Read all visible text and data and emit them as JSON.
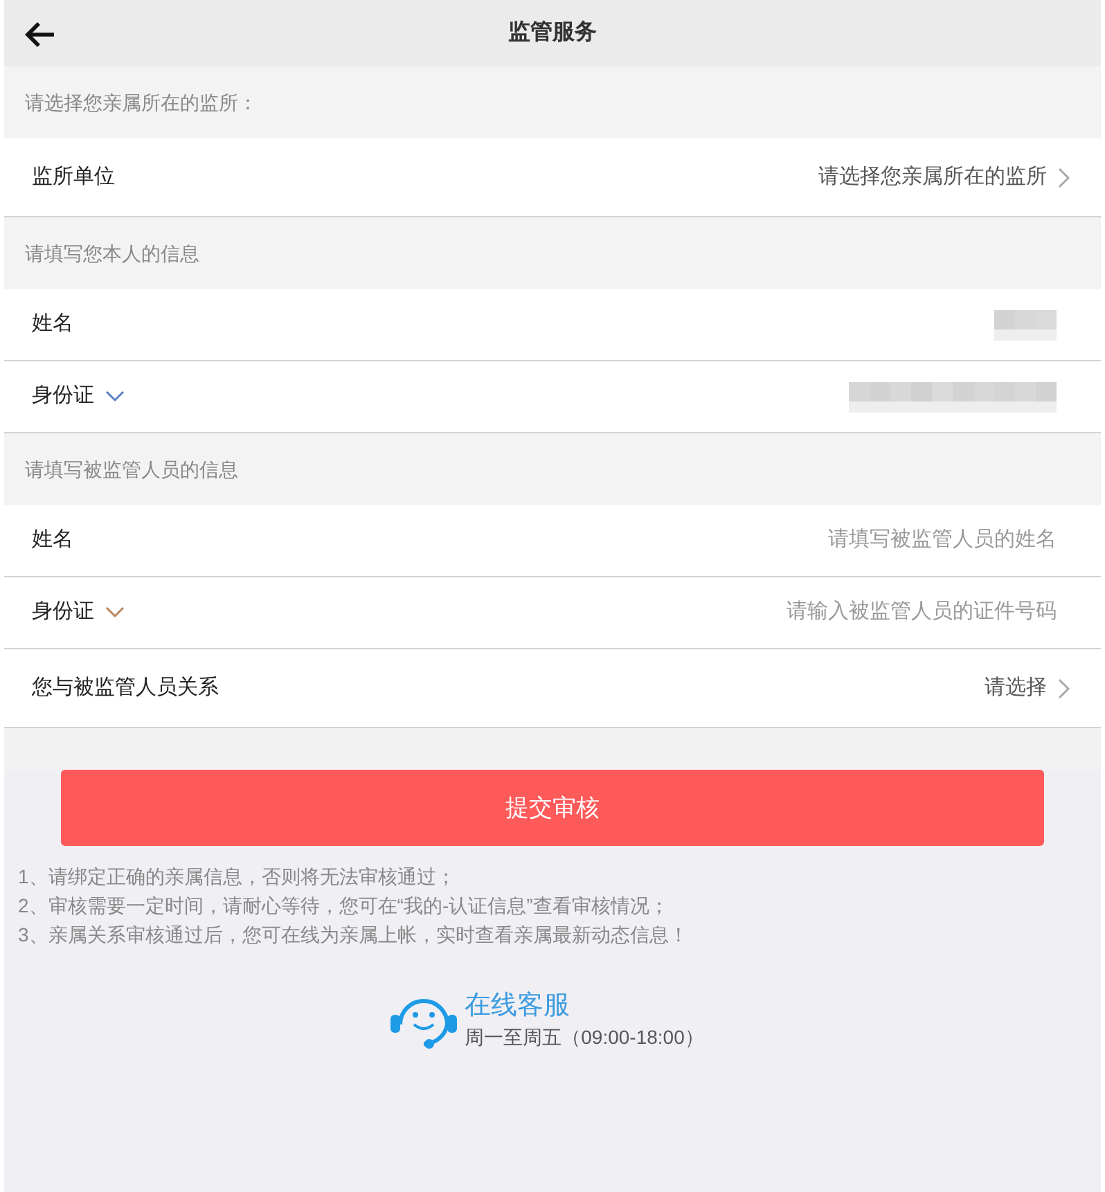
{
  "header": {
    "title": "监管服务"
  },
  "sections": [
    {
      "heading": "请选择您亲属所在的监所：",
      "rows": [
        {
          "kind": "select",
          "label": "监所单位",
          "value": "请选择您亲属所在的监所"
        }
      ]
    },
    {
      "heading": "请填写您本人的信息",
      "rows": [
        {
          "kind": "shortredacted",
          "label": "姓名"
        },
        {
          "kind": "longredacted",
          "label": "身份证",
          "caret": true,
          "color": "#5b7fc7"
        }
      ]
    },
    {
      "heading": "请填写被监管人员的信息",
      "rows": [
        {
          "kind": "input",
          "label": "姓名",
          "placeholder": "请填写被监管人员的姓名"
        },
        {
          "kind": "input",
          "label": "身份证",
          "placeholder": "请输入被监管人员的证件号码",
          "caret": true,
          "color": "#b8865a"
        },
        {
          "kind": "select",
          "label": "您与被监管人员关系",
          "value": "请选择"
        }
      ]
    }
  ],
  "submit": "提交审核",
  "notes": [
    "1、请绑定正确的亲属信息，否则将无法审核通过；",
    "2、审核需要一定时间，请耐心等待，您可在“我的-认证信息”查看审核情况；",
    "3、亲属关系审核通过后，您可在线为亲属上帐，实时查看亲属最新动态信息！"
  ],
  "support": {
    "title": "在线客服",
    "hours": "周一至周五（09:00-18:00）"
  }
}
